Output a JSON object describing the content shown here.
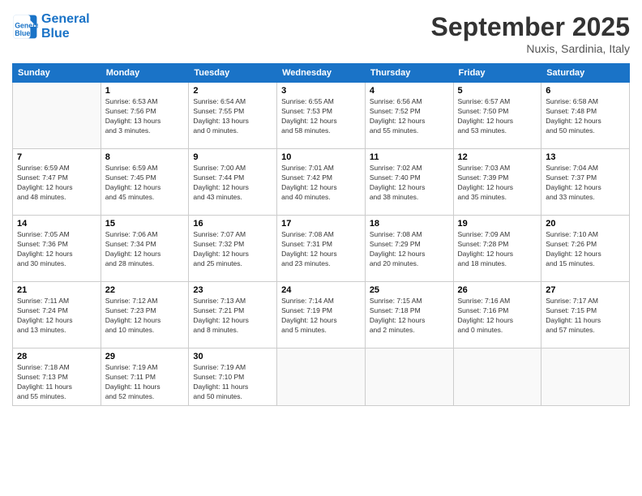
{
  "header": {
    "logo_line1": "General",
    "logo_line2": "Blue",
    "month": "September 2025",
    "location": "Nuxis, Sardinia, Italy"
  },
  "weekdays": [
    "Sunday",
    "Monday",
    "Tuesday",
    "Wednesday",
    "Thursday",
    "Friday",
    "Saturday"
  ],
  "weeks": [
    [
      {
        "day": "",
        "info": ""
      },
      {
        "day": "1",
        "info": "Sunrise: 6:53 AM\nSunset: 7:56 PM\nDaylight: 13 hours\nand 3 minutes."
      },
      {
        "day": "2",
        "info": "Sunrise: 6:54 AM\nSunset: 7:55 PM\nDaylight: 13 hours\nand 0 minutes."
      },
      {
        "day": "3",
        "info": "Sunrise: 6:55 AM\nSunset: 7:53 PM\nDaylight: 12 hours\nand 58 minutes."
      },
      {
        "day": "4",
        "info": "Sunrise: 6:56 AM\nSunset: 7:52 PM\nDaylight: 12 hours\nand 55 minutes."
      },
      {
        "day": "5",
        "info": "Sunrise: 6:57 AM\nSunset: 7:50 PM\nDaylight: 12 hours\nand 53 minutes."
      },
      {
        "day": "6",
        "info": "Sunrise: 6:58 AM\nSunset: 7:48 PM\nDaylight: 12 hours\nand 50 minutes."
      }
    ],
    [
      {
        "day": "7",
        "info": "Sunrise: 6:59 AM\nSunset: 7:47 PM\nDaylight: 12 hours\nand 48 minutes."
      },
      {
        "day": "8",
        "info": "Sunrise: 6:59 AM\nSunset: 7:45 PM\nDaylight: 12 hours\nand 45 minutes."
      },
      {
        "day": "9",
        "info": "Sunrise: 7:00 AM\nSunset: 7:44 PM\nDaylight: 12 hours\nand 43 minutes."
      },
      {
        "day": "10",
        "info": "Sunrise: 7:01 AM\nSunset: 7:42 PM\nDaylight: 12 hours\nand 40 minutes."
      },
      {
        "day": "11",
        "info": "Sunrise: 7:02 AM\nSunset: 7:40 PM\nDaylight: 12 hours\nand 38 minutes."
      },
      {
        "day": "12",
        "info": "Sunrise: 7:03 AM\nSunset: 7:39 PM\nDaylight: 12 hours\nand 35 minutes."
      },
      {
        "day": "13",
        "info": "Sunrise: 7:04 AM\nSunset: 7:37 PM\nDaylight: 12 hours\nand 33 minutes."
      }
    ],
    [
      {
        "day": "14",
        "info": "Sunrise: 7:05 AM\nSunset: 7:36 PM\nDaylight: 12 hours\nand 30 minutes."
      },
      {
        "day": "15",
        "info": "Sunrise: 7:06 AM\nSunset: 7:34 PM\nDaylight: 12 hours\nand 28 minutes."
      },
      {
        "day": "16",
        "info": "Sunrise: 7:07 AM\nSunset: 7:32 PM\nDaylight: 12 hours\nand 25 minutes."
      },
      {
        "day": "17",
        "info": "Sunrise: 7:08 AM\nSunset: 7:31 PM\nDaylight: 12 hours\nand 23 minutes."
      },
      {
        "day": "18",
        "info": "Sunrise: 7:08 AM\nSunset: 7:29 PM\nDaylight: 12 hours\nand 20 minutes."
      },
      {
        "day": "19",
        "info": "Sunrise: 7:09 AM\nSunset: 7:28 PM\nDaylight: 12 hours\nand 18 minutes."
      },
      {
        "day": "20",
        "info": "Sunrise: 7:10 AM\nSunset: 7:26 PM\nDaylight: 12 hours\nand 15 minutes."
      }
    ],
    [
      {
        "day": "21",
        "info": "Sunrise: 7:11 AM\nSunset: 7:24 PM\nDaylight: 12 hours\nand 13 minutes."
      },
      {
        "day": "22",
        "info": "Sunrise: 7:12 AM\nSunset: 7:23 PM\nDaylight: 12 hours\nand 10 minutes."
      },
      {
        "day": "23",
        "info": "Sunrise: 7:13 AM\nSunset: 7:21 PM\nDaylight: 12 hours\nand 8 minutes."
      },
      {
        "day": "24",
        "info": "Sunrise: 7:14 AM\nSunset: 7:19 PM\nDaylight: 12 hours\nand 5 minutes."
      },
      {
        "day": "25",
        "info": "Sunrise: 7:15 AM\nSunset: 7:18 PM\nDaylight: 12 hours\nand 2 minutes."
      },
      {
        "day": "26",
        "info": "Sunrise: 7:16 AM\nSunset: 7:16 PM\nDaylight: 12 hours\nand 0 minutes."
      },
      {
        "day": "27",
        "info": "Sunrise: 7:17 AM\nSunset: 7:15 PM\nDaylight: 11 hours\nand 57 minutes."
      }
    ],
    [
      {
        "day": "28",
        "info": "Sunrise: 7:18 AM\nSunset: 7:13 PM\nDaylight: 11 hours\nand 55 minutes."
      },
      {
        "day": "29",
        "info": "Sunrise: 7:19 AM\nSunset: 7:11 PM\nDaylight: 11 hours\nand 52 minutes."
      },
      {
        "day": "30",
        "info": "Sunrise: 7:19 AM\nSunset: 7:10 PM\nDaylight: 11 hours\nand 50 minutes."
      },
      {
        "day": "",
        "info": ""
      },
      {
        "day": "",
        "info": ""
      },
      {
        "day": "",
        "info": ""
      },
      {
        "day": "",
        "info": ""
      }
    ]
  ]
}
